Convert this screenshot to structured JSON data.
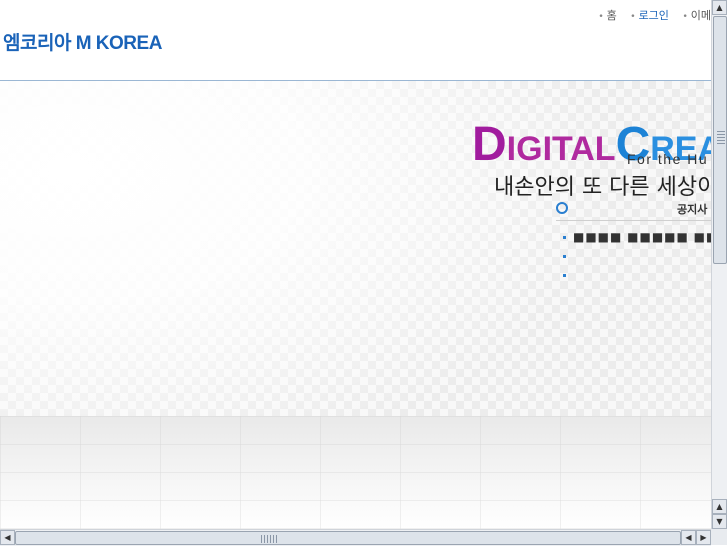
{
  "header": {
    "logo_text": "엠코리아 M KOREA",
    "nav": [
      {
        "label": "홈"
      },
      {
        "label": "로그인"
      },
      {
        "label": "이메"
      }
    ]
  },
  "banner": {
    "digital_initial": "D",
    "digital_rest": "IGITAL",
    "create_initial": "C",
    "create_rest": "REA",
    "tagline_en": "For the Hu",
    "tagline_ko": "내손안의 또 다른 세상이"
  },
  "notice": {
    "title": "공지사",
    "items": [
      {
        "text": "■■■■ ■■■■■ ■■"
      },
      {
        "text": ""
      },
      {
        "text": ""
      }
    ]
  },
  "colors": {
    "brand_blue": "#1a63b8",
    "digital_purple": "#a11c9e",
    "create_blue": "#1d83d6"
  },
  "icons": {
    "scroll_up": "up-arrow-icon",
    "scroll_down": "down-arrow-icon",
    "scroll_left": "left-arrow-icon",
    "scroll_right": "right-arrow-icon"
  }
}
